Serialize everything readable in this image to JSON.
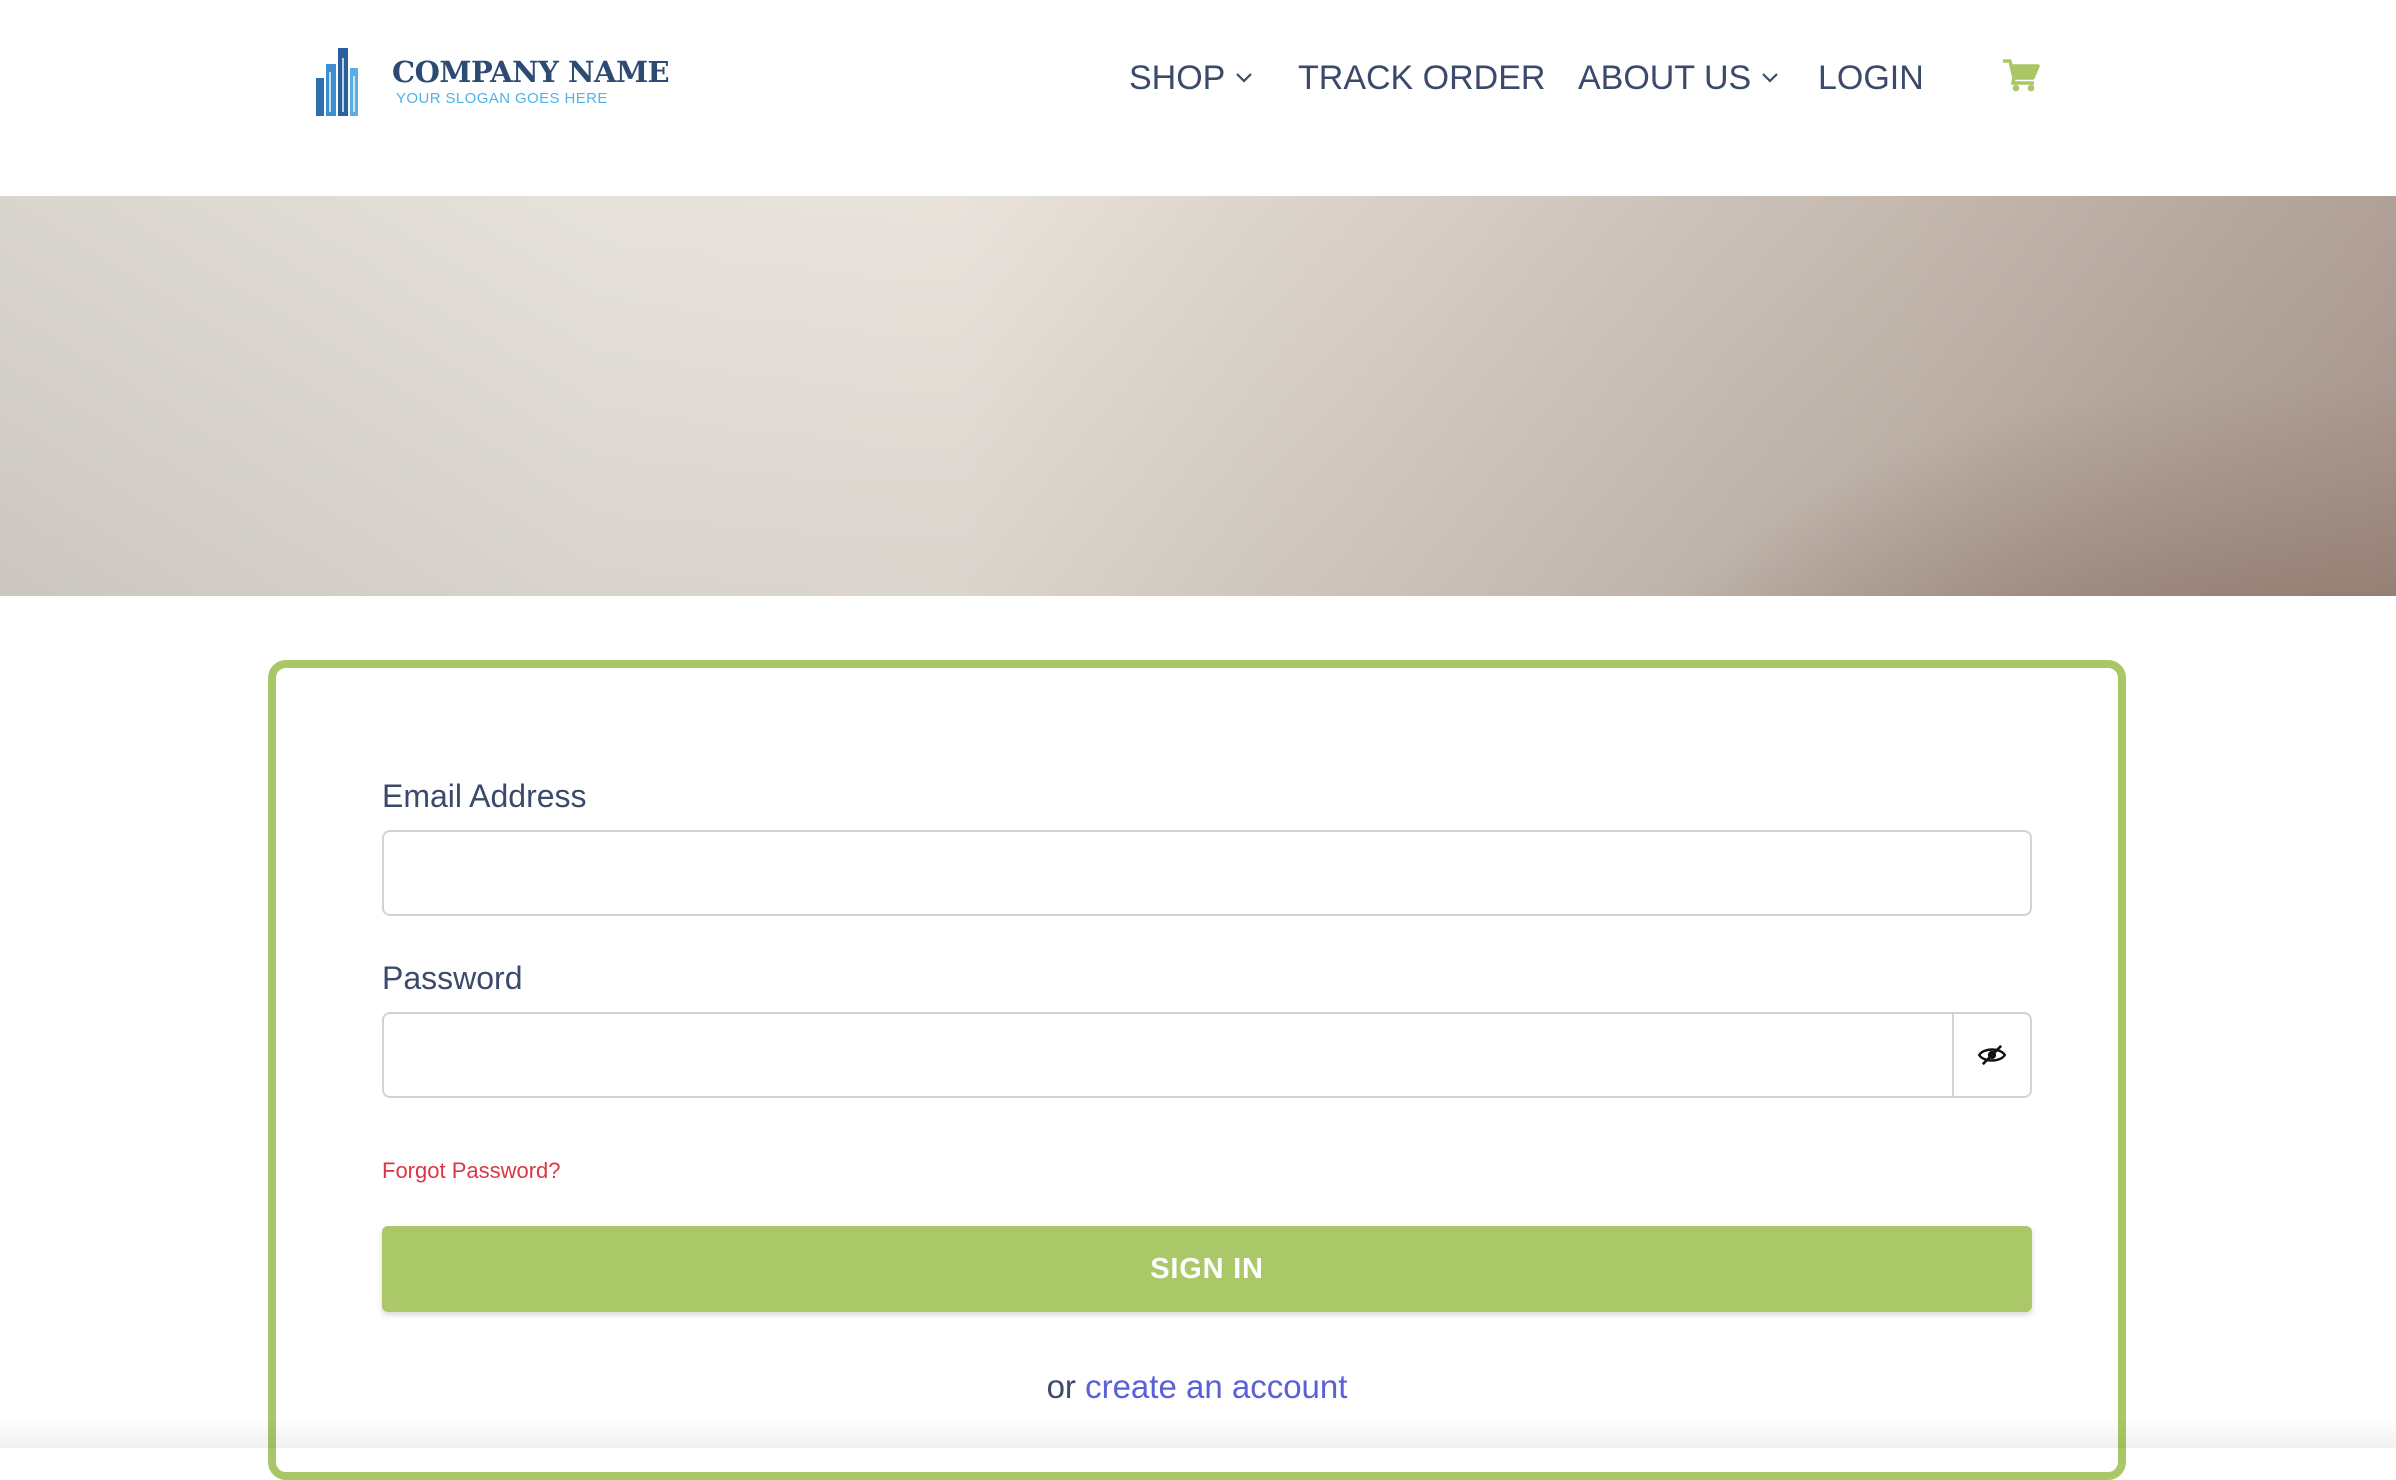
{
  "brand": {
    "name": "COMPANY NAME",
    "slogan": "YOUR SLOGAN GOES HERE",
    "logo_icon": "building-logo-icon"
  },
  "nav": {
    "shop": "SHOP",
    "track_order": "TRACK ORDER",
    "about_us": "ABOUT US",
    "login": "LOGIN",
    "cart_icon": "shopping-cart-icon"
  },
  "login_form": {
    "email_label": "Email Address",
    "email_value": "",
    "password_label": "Password",
    "password_value": "",
    "toggle_icon": "eye-slash-icon",
    "forgot_password": "Forgot Password?",
    "sign_in": "SIGN IN",
    "or_text": "or",
    "create_account": "create an account"
  },
  "colors": {
    "accent_green": "#abc868",
    "nav_text": "#3b4a6b",
    "link_blue": "#5a60d6",
    "forgot_red": "#dc3545",
    "cart_green": "#a9c766"
  }
}
